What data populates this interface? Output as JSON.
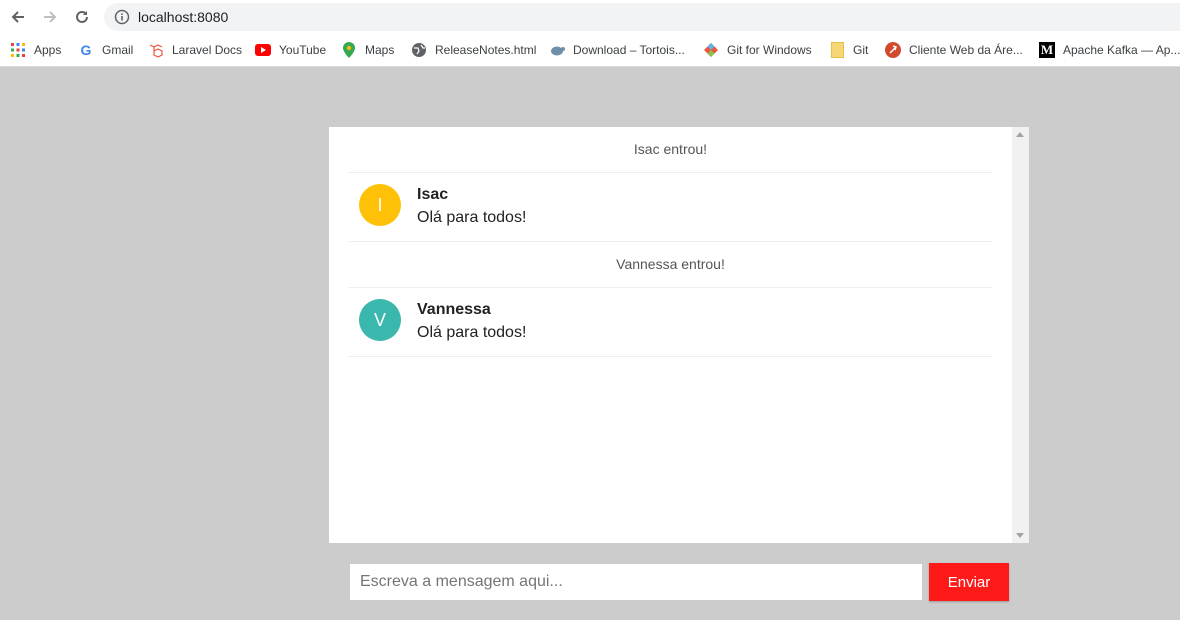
{
  "browser": {
    "url": "localhost:8080",
    "bookmarks": [
      {
        "label": "Apps",
        "icon": "apps-grid-icon"
      },
      {
        "label": "Gmail",
        "icon": "google-icon"
      },
      {
        "label": "Laravel Docs",
        "icon": "laravel-icon"
      },
      {
        "label": "YouTube",
        "icon": "youtube-icon"
      },
      {
        "label": "Maps",
        "icon": "maps-pin-icon"
      },
      {
        "label": "ReleaseNotes.html",
        "icon": "globe-icon"
      },
      {
        "label": "Download – Tortois...",
        "icon": "tortoise-icon"
      },
      {
        "label": "Git for Windows",
        "icon": "git-diamond-icon"
      },
      {
        "label": "Git",
        "icon": "folder-icon"
      },
      {
        "label": "Cliente Web da Áre...",
        "icon": "red-circle-icon"
      },
      {
        "label": "Apache Kafka — Ap...",
        "icon": "medium-m-icon"
      }
    ]
  },
  "chat": {
    "items": [
      {
        "type": "notice",
        "text": "Isac entrou!"
      },
      {
        "type": "message",
        "initial": "I",
        "user": "Isac",
        "text": "Olá para todos!",
        "avatar_color": "#ffc107"
      },
      {
        "type": "notice",
        "text": "Vannessa entrou!"
      },
      {
        "type": "message",
        "initial": "V",
        "user": "Vannessa",
        "text": "Olá para todos!",
        "avatar_color": "#3ab8ad"
      }
    ]
  },
  "composer": {
    "placeholder": "Escreva a mensagem aqui...",
    "send_label": "Enviar",
    "send_color": "#ff1a1a"
  }
}
